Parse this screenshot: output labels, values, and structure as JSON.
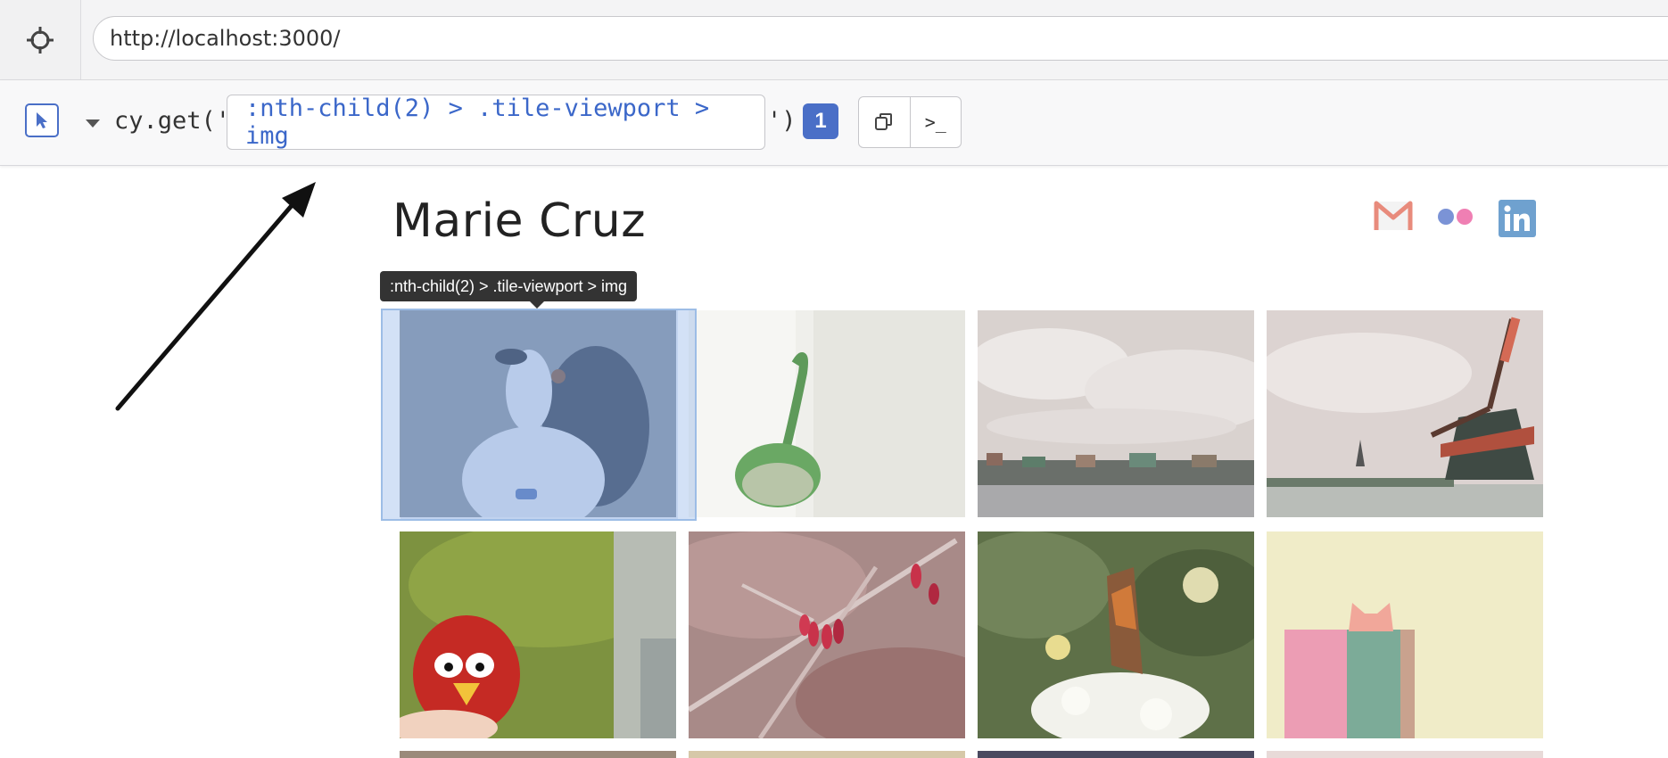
{
  "url_bar": {
    "url": "http://localhost:3000/",
    "target_icon": "crosshair-icon"
  },
  "selector_playground": {
    "pointer_icon": "cursor-icon",
    "command_prefix": "cy.get('",
    "selector": ":nth-child(2) > .tile-viewport > img",
    "command_suffix": "')",
    "match_count": "1",
    "copy_icon": "copy-icon",
    "print_icon": "terminal-icon",
    "accent_color": "#4a6fc7"
  },
  "site": {
    "title": "Marie Cruz",
    "social_icons": [
      "gmail-icon",
      "flickr-icon",
      "linkedin-icon"
    ]
  },
  "tooltip": {
    "text": ":nth-child(2) > .tile-viewport > img"
  },
  "gallery": {
    "tiles": [
      {
        "subject": "dog"
      },
      {
        "subject": "origami-swan"
      },
      {
        "subject": "village-waterfront"
      },
      {
        "subject": "windmill"
      },
      {
        "subject": "origami-red-bird"
      },
      {
        "subject": "red-berries"
      },
      {
        "subject": "butterfly"
      },
      {
        "subject": "origami-cat-book"
      }
    ]
  }
}
